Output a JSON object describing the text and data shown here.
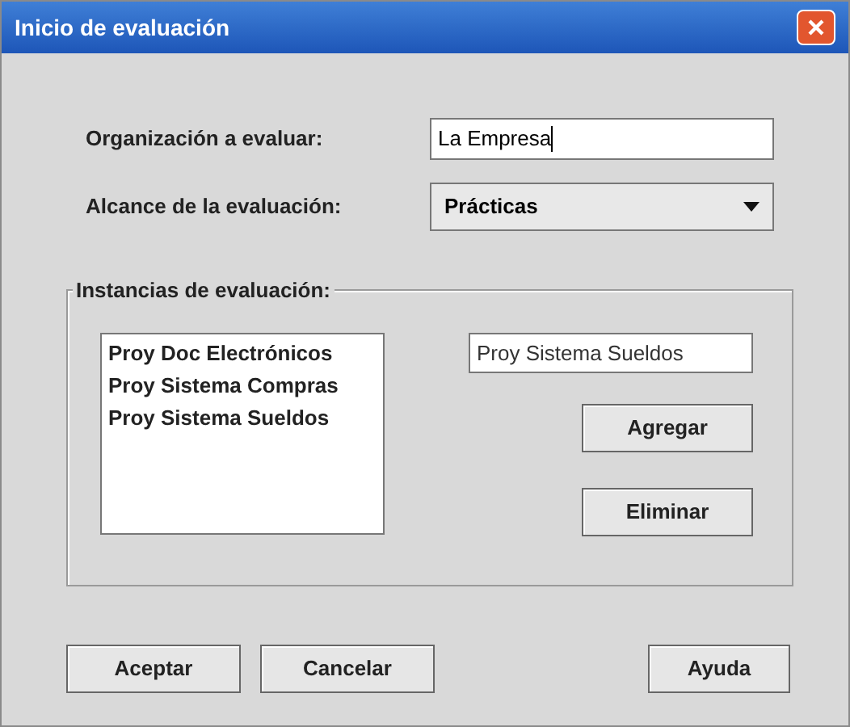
{
  "window": {
    "title": "Inicio de evaluación"
  },
  "organization": {
    "label": "Organización a evaluar:",
    "value": "La Empresa"
  },
  "scope": {
    "label": "Alcance de la evaluación:",
    "value": "Prácticas"
  },
  "instances": {
    "title": "Instancias de evaluación:",
    "items": [
      {
        "text": "Proy Doc Electrónicos"
      },
      {
        "text": "Proy Sistema Compras"
      },
      {
        "text": "Proy Sistema Sueldos"
      }
    ],
    "input": {
      "value": "Proy Sistema Sueldos"
    },
    "buttons": [
      "Agregar",
      "Eliminar"
    ]
  },
  "footer_buttons": [
    "Aceptar",
    "Cancelar",
    "Ayuda"
  ]
}
